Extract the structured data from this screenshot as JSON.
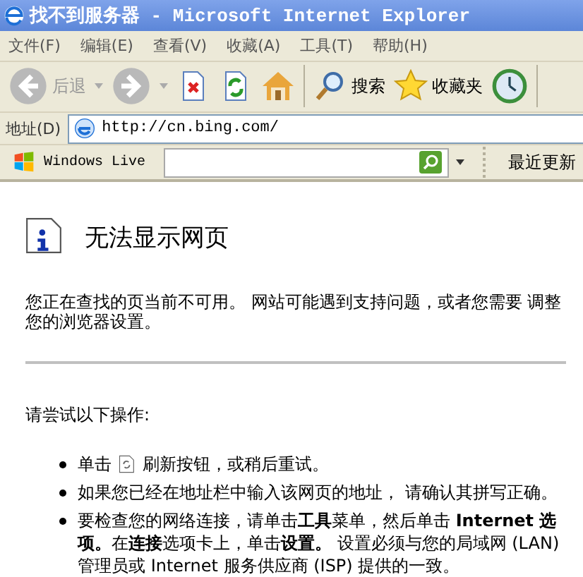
{
  "window": {
    "title": "找不到服务器 - Microsoft Internet Explorer"
  },
  "menu": [
    "文件(F)",
    "编辑(E)",
    "查看(V)",
    "收藏(A)",
    "工具(T)",
    "帮助(H)"
  ],
  "toolbar": [
    {
      "kind": "back",
      "label": "后退",
      "disabled": true
    },
    {
      "kind": "forward",
      "disabled": true
    },
    {
      "kind": "stop"
    },
    {
      "kind": "refresh"
    },
    {
      "kind": "home"
    },
    {
      "kind": "separator"
    },
    {
      "kind": "search",
      "label": "搜索"
    },
    {
      "kind": "favorites",
      "label": "收藏夹"
    },
    {
      "kind": "history"
    }
  ],
  "address_bar": {
    "label": "地址(D)",
    "value": "http://cn.bing.com/"
  },
  "links_bar": {
    "brand": "Windows Live",
    "link": "最近更新"
  },
  "page": {
    "heading": "无法显示网页",
    "intro": "您正在查找的页当前不可用。 网站可能遇到支持问题，或者您需要 调整您的浏览器设置。",
    "prompt": "请尝试以下操作:",
    "items": [
      {
        "kind": "icon_text",
        "lead": "单击",
        "text": "刷新按钮，或稍后重试。"
      },
      {
        "kind": "text",
        "text": "如果您已经在地址栏中输入该网页的地址， 请确认其拼写正确。"
      },
      {
        "kind": "text",
        "text": "要检查您的网络连接，请单击**工具**菜单，然后单击 **Internet 选项。**在**连接**选项卡上，单击**设置。** 设置必须与您的局域网 (LAN) 管理员或 Internet 服务供应商 (ISP) 提供的一致。"
      }
    ]
  }
}
